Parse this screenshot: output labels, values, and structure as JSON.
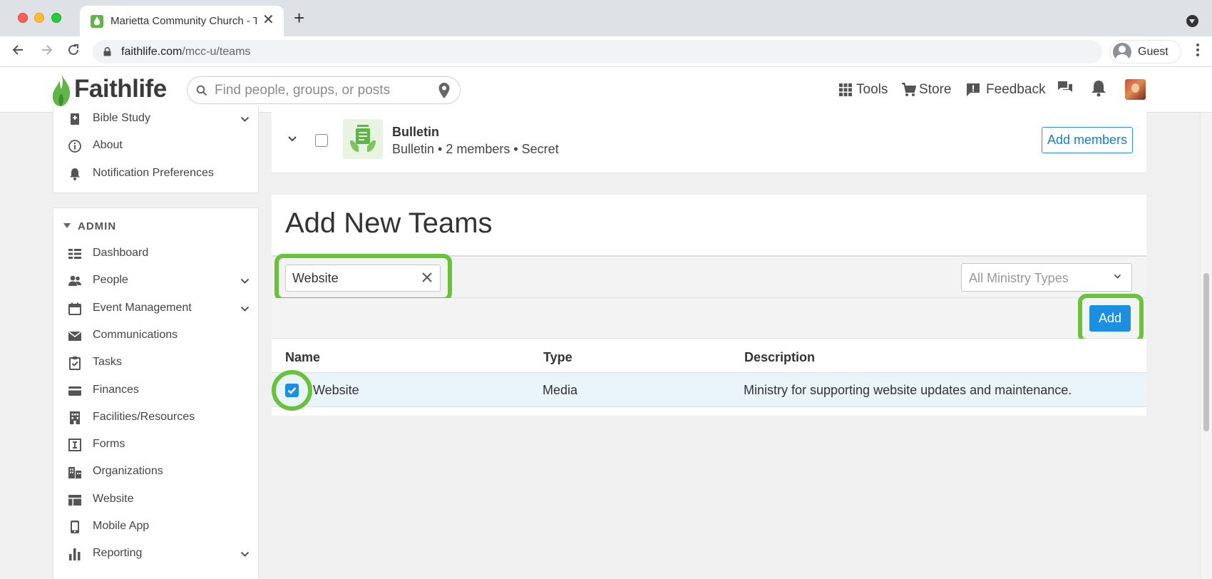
{
  "browser": {
    "tab_title": "Marietta Community Church - T",
    "tab_close": "✕",
    "new_tab": "+",
    "url_host": "faithlife.com",
    "url_path": "/mcc-u/teams",
    "profile_label": "Guest"
  },
  "header": {
    "logo_text": "Faithlife",
    "search_placeholder": "Find people, groups, or posts",
    "tools_label": "Tools",
    "store_label": "Store",
    "feedback_label": "Feedback"
  },
  "sidebar": {
    "top_items": [
      {
        "label": "Bible Study",
        "icon": "book-icon",
        "expandable": true
      },
      {
        "label": "About",
        "icon": "info-icon",
        "expandable": false
      },
      {
        "label": "Notification Preferences",
        "icon": "bell-icon",
        "expandable": false
      }
    ],
    "admin_heading": "ADMIN",
    "admin_items": [
      {
        "label": "Dashboard",
        "icon": "dashboard-icon",
        "expandable": false
      },
      {
        "label": "People",
        "icon": "people-icon",
        "expandable": true
      },
      {
        "label": "Event Management",
        "icon": "calendar-icon",
        "expandable": true
      },
      {
        "label": "Communications",
        "icon": "mail-icon",
        "expandable": false
      },
      {
        "label": "Tasks",
        "icon": "clipboard-icon",
        "expandable": false
      },
      {
        "label": "Finances",
        "icon": "credit-card-icon",
        "expandable": false
      },
      {
        "label": "Facilities/Resources",
        "icon": "building-icon",
        "expandable": false
      },
      {
        "label": "Forms",
        "icon": "form-icon",
        "expandable": false
      },
      {
        "label": "Organizations",
        "icon": "organization-icon",
        "expandable": false
      },
      {
        "label": "Website",
        "icon": "website-icon",
        "expandable": false
      },
      {
        "label": "Mobile App",
        "icon": "mobile-icon",
        "expandable": false
      },
      {
        "label": "Reporting",
        "icon": "bar-chart-icon",
        "expandable": true
      }
    ]
  },
  "bulletin": {
    "name": "Bulletin",
    "meta": "Bulletin • 2 members • Secret",
    "add_members_label": "Add members"
  },
  "add_teams": {
    "title": "Add New Teams",
    "search_value": "Website",
    "type_select": "All Ministry Types",
    "add_label": "Add",
    "columns": [
      "Name",
      "Type",
      "Description"
    ],
    "rows": [
      {
        "checked": true,
        "name": "Website",
        "type": "Media",
        "description": "Ministry for supporting website updates and maintenance."
      }
    ]
  },
  "colors": {
    "brand_green": "#5fb548",
    "highlight_green": "#6ac23a",
    "primary_blue": "#1d8fe1",
    "selected_row": "#e9f4fb"
  }
}
